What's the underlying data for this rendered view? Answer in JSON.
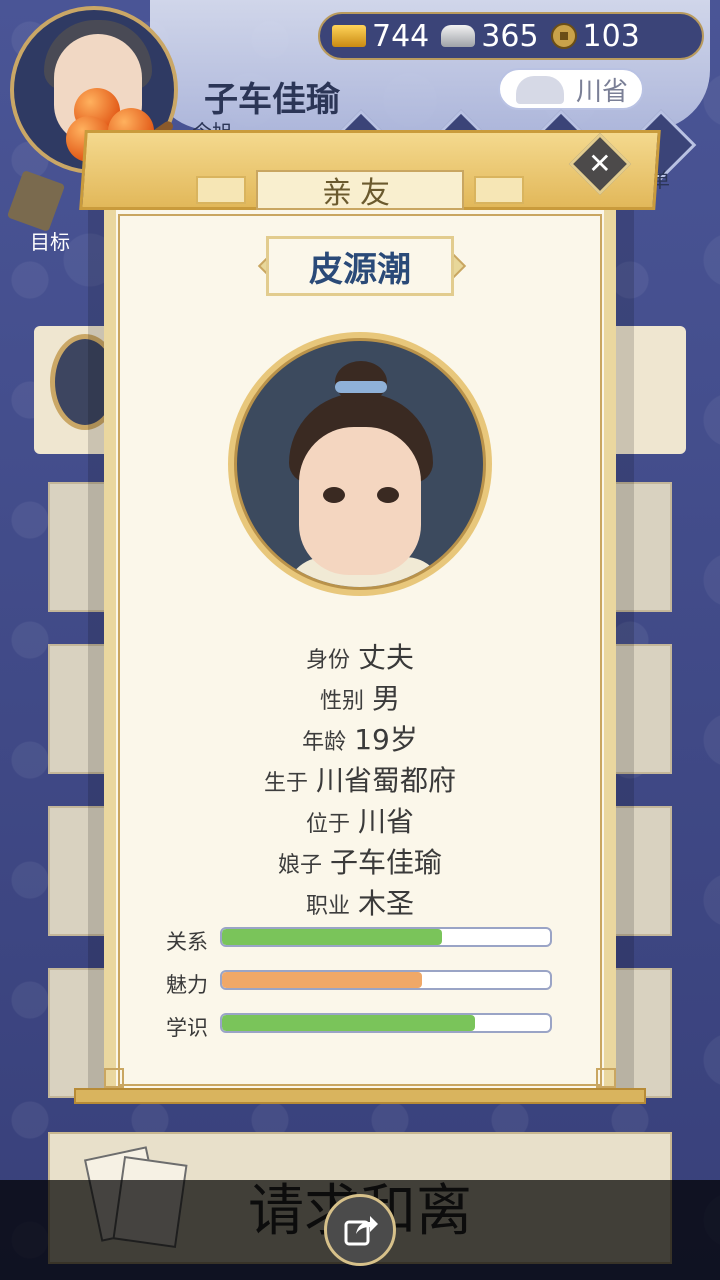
{
  "header": {
    "player_name": "子车佳瑜",
    "subtitle": "今旭",
    "region": "川省",
    "menu_label": "菜单",
    "target_label": "目标"
  },
  "resources": {
    "gold": "744",
    "silver": "365",
    "coin": "103"
  },
  "modal": {
    "title": "亲友",
    "close_symbol": "✕",
    "name": "皮源潮",
    "info": [
      {
        "key": "身份",
        "value": "丈夫"
      },
      {
        "key": "性别",
        "value": "男"
      },
      {
        "key": "年龄",
        "value": "19岁"
      },
      {
        "key": "生于",
        "value": "川省蜀都府"
      },
      {
        "key": "位于",
        "value": "川省"
      },
      {
        "key": "娘子",
        "value": "子车佳瑜"
      },
      {
        "key": "职业",
        "value": "木圣"
      }
    ],
    "stats": [
      {
        "label": "关系",
        "fraction": 0.67,
        "color": "#7ac45a"
      },
      {
        "label": "魅力",
        "fraction": 0.61,
        "color": "#f0a868"
      },
      {
        "label": "学识",
        "fraction": 0.77,
        "color": "#7ac45a"
      }
    ]
  },
  "bottom": {
    "divorce_label": "请求和离",
    "share_icon": "share-icon"
  }
}
